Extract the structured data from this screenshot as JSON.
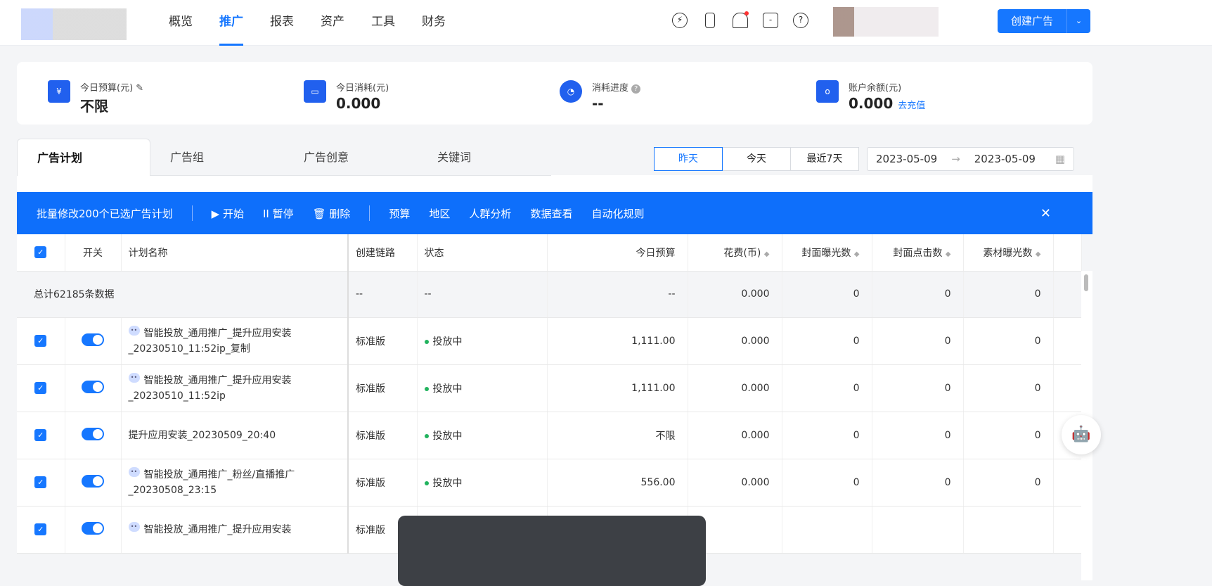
{
  "nav": {
    "items": [
      "概览",
      "推广",
      "报表",
      "资产",
      "工具",
      "财务"
    ],
    "active": 1,
    "create_label": "创建广告"
  },
  "summary": {
    "budget": {
      "label": "今日预算(元)",
      "value": "不限"
    },
    "spend": {
      "label": "今日消耗(元)",
      "value": "0.000"
    },
    "progress": {
      "label": "消耗进度",
      "value": "--"
    },
    "balance": {
      "label": "账户余额(元)",
      "value": "0.000",
      "link": "去充值"
    }
  },
  "tabs": [
    "广告计划",
    "广告组",
    "广告创意",
    "关键词"
  ],
  "date_buttons": [
    "昨天",
    "今天",
    "最近7天"
  ],
  "date_range": {
    "start": "2023-05-09",
    "end": "2023-05-09",
    "arrow": "→"
  },
  "batch_bar": {
    "title": "批量修改200个已选广告计划",
    "start": "▶ 开始",
    "pause": "II 暂停",
    "delete": "🗑 删除",
    "actions": [
      "预算",
      "地区",
      "人群分析",
      "数据查看",
      "自动化规则"
    ],
    "close": "✕"
  },
  "table": {
    "headers": [
      "开关",
      "计划名称",
      "创建链路",
      "状态",
      "今日预算",
      "花费(币)",
      "封面曝光数",
      "封面点击数",
      "素材曝光数"
    ],
    "total": {
      "label": "总计62185条数据",
      "chain": "--",
      "status": "--",
      "budget": "--",
      "spend": "0.000",
      "cover_exp": "0",
      "cover_click": "0",
      "material_exp": "0"
    },
    "rows": [
      {
        "name": "智能投放_通用推广_提升应用安装_20230510_11:52ip_复制",
        "bot": true,
        "chain": "标准版",
        "status": "投放中",
        "budget": "1,111.00",
        "spend": "0.000",
        "cover_exp": "0",
        "cover_click": "0",
        "material_exp": "0"
      },
      {
        "name": "智能投放_通用推广_提升应用安装_20230510_11:52ip",
        "bot": true,
        "chain": "标准版",
        "status": "投放中",
        "budget": "1,111.00",
        "spend": "0.000",
        "cover_exp": "0",
        "cover_click": "0",
        "material_exp": "0"
      },
      {
        "name": "提升应用安装_20230509_20:40",
        "bot": false,
        "chain": "标准版",
        "status": "投放中",
        "budget": "不限",
        "spend": "0.000",
        "cover_exp": "0",
        "cover_click": "0",
        "material_exp": "0"
      },
      {
        "name": "智能投放_通用推广_粉丝/直播推广_20230508_23:15",
        "bot": true,
        "chain": "标准版",
        "status": "投放中",
        "budget": "556.00",
        "spend": "0.000",
        "cover_exp": "0",
        "cover_click": "0",
        "material_exp": "0"
      },
      {
        "name": "智能投放_通用推广_提升应用安装",
        "bot": true,
        "chain": "标准版",
        "status": "",
        "budget": "",
        "spend": "",
        "cover_exp": "",
        "cover_click": "",
        "material_exp": ""
      }
    ]
  },
  "colors": {
    "accent": "#1677ff",
    "batch_bar": "#0e6ffb",
    "status_green": "#22b35e"
  }
}
